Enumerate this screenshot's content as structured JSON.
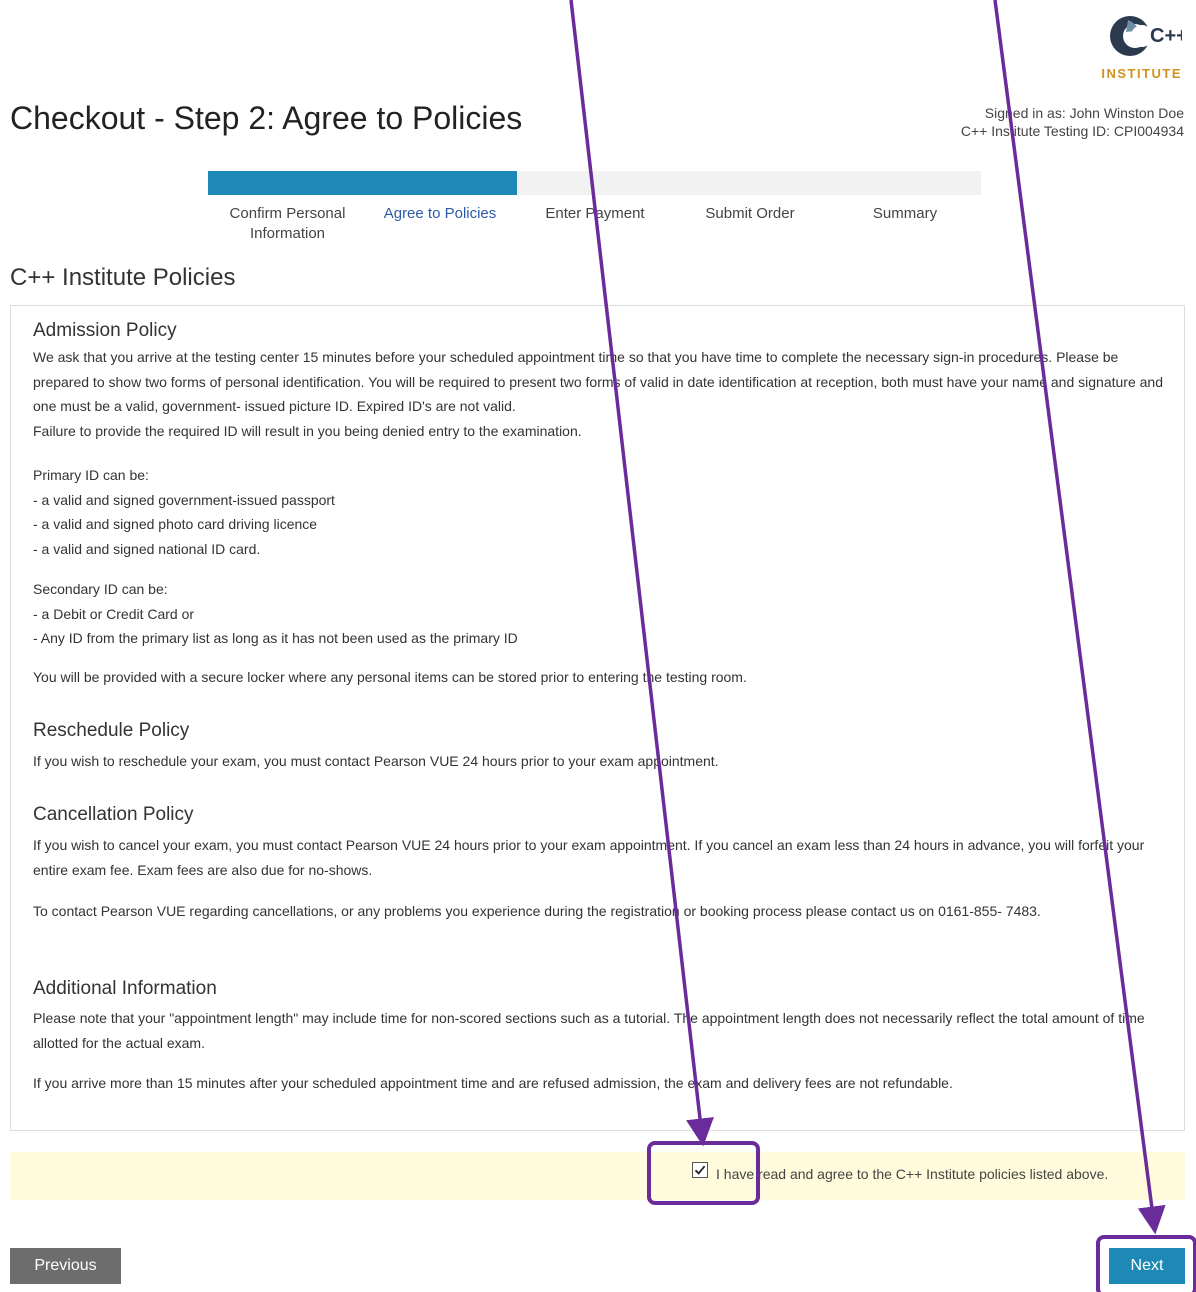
{
  "brand": {
    "logo_text": "INSTITUTE",
    "logo_mark": "C++",
    "accent_color": "#1e88b6",
    "logo_color": "#d2931e"
  },
  "header": {
    "title": "Checkout - Step 2: Agree to Policies",
    "signed_in": "Signed in as: John Winston Doe",
    "testing_id": "C++ Institute Testing ID: CPI004934"
  },
  "progress": {
    "fraction": 0.4,
    "steps": [
      {
        "label": "Confirm Personal\nInformation",
        "active": false
      },
      {
        "label": "Agree to Policies",
        "active": true
      },
      {
        "label": "Enter Payment",
        "active": false
      },
      {
        "label": "Submit Order",
        "active": false
      },
      {
        "label": "Summary",
        "active": false
      }
    ]
  },
  "policies": {
    "section_title": "C++ Institute Policies",
    "admission": {
      "heading": "Admission Policy",
      "p1": "We ask that you arrive at the testing center 15 minutes before your scheduled appointment time so that you have time to complete the necessary sign-in procedures. Please be prepared to show two forms of personal identification. You will be required to present two forms of valid in date identification at reception, both must have your name and signature and one must be a valid, government- issued picture ID. Expired ID's are not valid.",
      "p2": "Failure to provide the required ID will result in you being denied entry to the examination.",
      "primary_title": "Primary ID can be:",
      "primary_items": [
        "- a valid and signed government-issued passport",
        "- a valid and signed photo card driving licence",
        "- a valid and signed national ID card."
      ],
      "secondary_title": "Secondary ID can be:",
      "secondary_items": [
        "- a Debit or Credit Card or",
        "- Any ID from the primary list as long as it has not been used as the primary ID"
      ],
      "locker": "You will be provided with a secure locker where any personal items can be stored prior to entering the testing room."
    },
    "reschedule": {
      "heading": "Reschedule Policy",
      "text": "If you wish to reschedule your exam, you must contact Pearson VUE 24 hours prior to your exam appointment."
    },
    "cancellation": {
      "heading": "Cancellation Policy",
      "text": "If you wish to cancel your exam, you must contact Pearson VUE 24 hours prior to your exam appointment. If you cancel an exam less than 24 hours in advance, you will forfeit your entire exam fee. Exam fees are also due for no-shows.",
      "contact": "To contact Pearson VUE regarding cancellations, or any problems you experience during the registration or booking process please contact us on 0161-855- 7483."
    },
    "additional": {
      "heading": "Additional Information",
      "text": "Please note that your \"appointment length\" may include time for non-scored sections such as a tutorial. The appointment length does not necessarily reflect the total amount of time allotted for the actual exam.",
      "late": "If you arrive more than 15 minutes after your scheduled appointment time and are refused admission, the exam and delivery fees are not refundable."
    }
  },
  "agree": {
    "checked": true,
    "label": "I have read and agree to the C++ Institute policies listed above."
  },
  "buttons": {
    "previous": "Previous",
    "next": "Next"
  },
  "annotation_color": "#6a2c9a"
}
